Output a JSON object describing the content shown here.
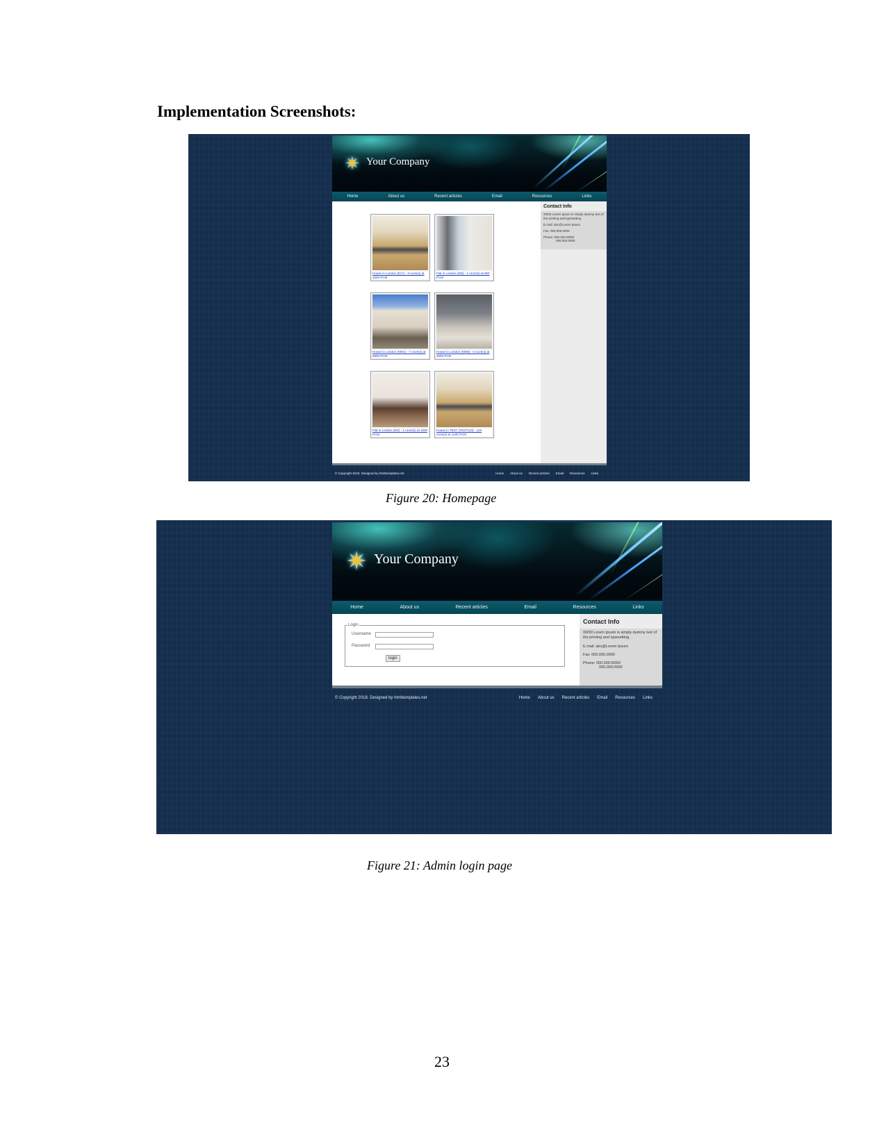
{
  "document": {
    "heading": "Implementation Screenshots:",
    "page_number": "23"
  },
  "figures": [
    {
      "caption": "Figure 20: Homepage",
      "site": {
        "brand": "Your Company",
        "nav": [
          "Home",
          "About us",
          "Recent articles",
          "Email",
          "Resources",
          "Links"
        ],
        "contact": {
          "title": "Contact Info",
          "description": "00/00 Lorem Ipsum is simply dummy text of the printing and typesetting.",
          "email": "E.mail: abc@Lorem Ipsum",
          "fax": "Fax: 000.000.0000",
          "phone": "Phone: 000.000.0000/",
          "phone2": "000.000.0000"
        },
        "listings": [
          {
            "caption": "House in London (E17) - 3 room(s) at 1500 PCM",
            "image": "kitchen-living-room-photo"
          },
          {
            "caption": "Flat in London (W5) - 1 room(s) at 950 PCM",
            "image": "bright-flat-window-photo"
          },
          {
            "caption": "House in London (NW1) - 7 room(s) at 5800 PCM",
            "image": "georgian-building-photo"
          },
          {
            "caption": "House in London (NW8) - 5 room(s) at 2000 PCM",
            "image": "open-plan-lounge-photo"
          },
          {
            "caption": "Flat in London (W2) - 1 room(s) at 1000 PCM",
            "image": "living-room-sofa-photo"
          },
          {
            "caption": "House in TEST (TEST123) - 123 room(s) at 1230 PCM",
            "image": "kitchen-living-room-photo"
          }
        ],
        "footer": {
          "copyright": "© Copyright 2018. Designed by htmltemplates.net",
          "links": [
            "Home",
            "About us",
            "Recent articles",
            "Email",
            "Resources",
            "Links"
          ]
        }
      }
    },
    {
      "caption": "Figure 21: Admin login page",
      "site": {
        "brand": "Your Company",
        "nav": [
          "Home",
          "About us",
          "Recent articles",
          "Email",
          "Resources",
          "Links"
        ],
        "login": {
          "legend": "Login",
          "username_label": "Username",
          "username_value": "",
          "password_label": "Password",
          "password_value": "",
          "submit_label": "login"
        },
        "contact": {
          "title": "Contact Info",
          "description": "00/00 Lorem Ipsum is simply dummy text of the printing and typesetting.",
          "email": "E.mail: abc@Lorem Ipsum",
          "fax": "Fax: 000.000.0000",
          "phone": "Phone: 000.000.0000/",
          "phone2": "000.000.0000"
        },
        "footer": {
          "copyright": "© Copyright 2018. Designed by htmltemplates.net",
          "links": [
            "Home",
            "About us",
            "Recent articles",
            "Email",
            "Resources",
            "Links"
          ]
        }
      }
    }
  ]
}
